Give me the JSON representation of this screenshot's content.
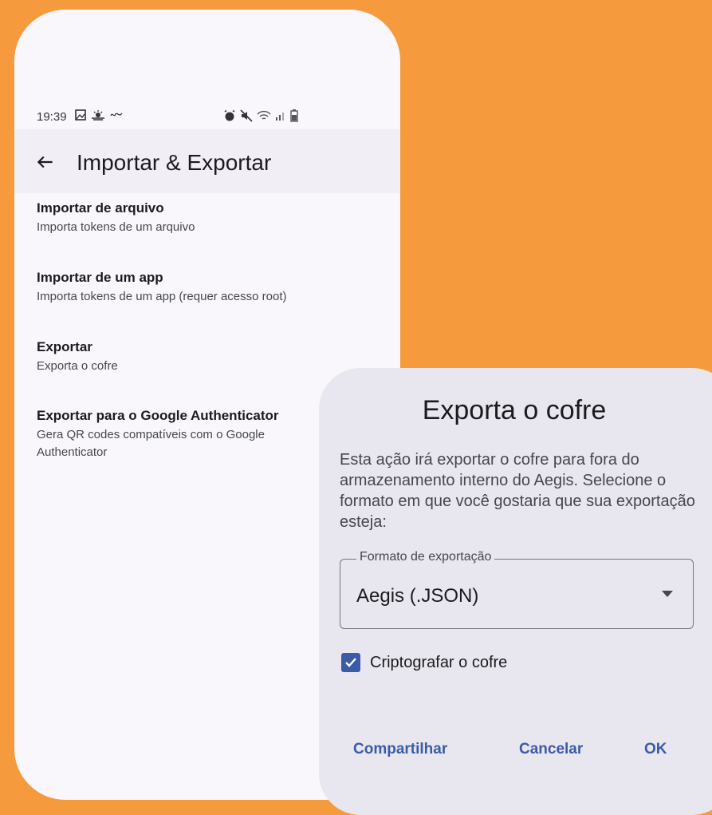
{
  "statusbar": {
    "time": "19:39",
    "left_icons": [
      "gallery-icon",
      "weather-icon",
      "notification-icon"
    ],
    "right_icons": [
      "alarm-icon",
      "mute-icon",
      "wifi-icon",
      "signal-icon",
      "battery-icon"
    ]
  },
  "appbar": {
    "title": "Importar & Exportar",
    "back_icon": "arrow-left-icon"
  },
  "menu": {
    "items": [
      {
        "title": "Importar de arquivo",
        "subtitle": "Importa tokens de um arquivo"
      },
      {
        "title": "Importar de um app",
        "subtitle": "Importa tokens de um app (requer acesso root)"
      },
      {
        "title": "Exportar",
        "subtitle": "Exporta o cofre"
      },
      {
        "title": "Exportar para o Google Authenticator",
        "subtitle": "Gera QR codes compatíveis com o Google Authenticator"
      }
    ]
  },
  "dialog": {
    "title": "Exporta o cofre",
    "body": "Esta ação irá exportar o cofre para fora do armazenamento interno do Aegis. Selecione o formato em que você gostaria que sua exportação esteja:",
    "format_label": "Formato de exportação",
    "format_value": "Aegis (.JSON)",
    "encrypt_label": "Criptografar o cofre",
    "encrypt_checked": true,
    "buttons": {
      "share": "Compartilhar",
      "cancel": "Cancelar",
      "ok": "OK"
    }
  },
  "colors": {
    "background": "#F59B3D",
    "accent": "#3B5BA9",
    "surface": "#F9F7FC",
    "dialog_surface": "#E8E7EF"
  }
}
